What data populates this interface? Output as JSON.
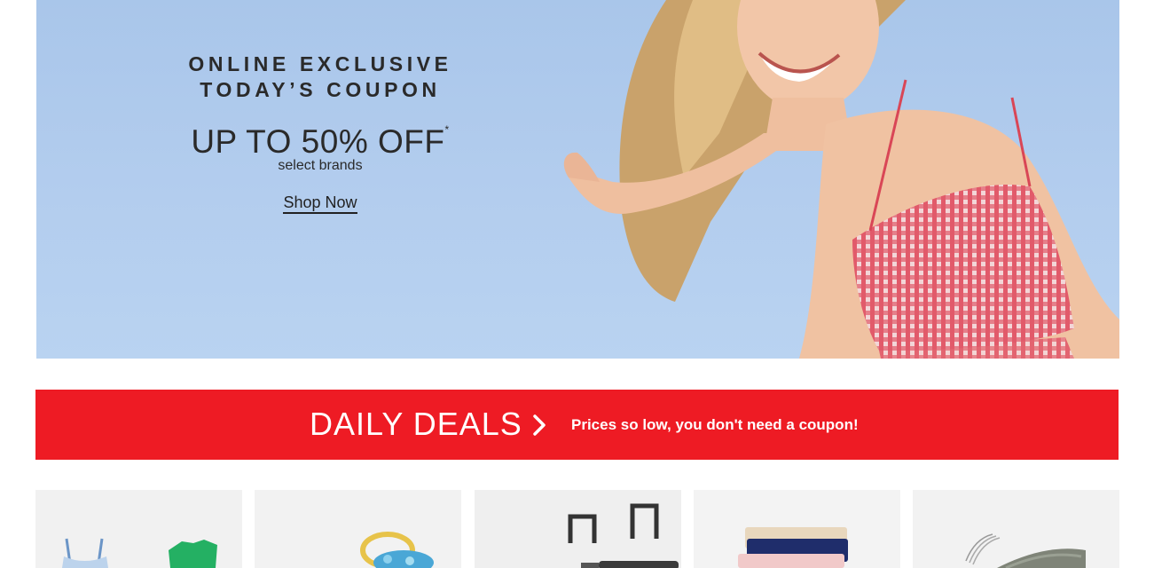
{
  "hero": {
    "line1": "ONLINE EXCLUSIVE",
    "line2": "TODAY’S COUPON",
    "offer": "UP TO 50% OFF",
    "offer_mark": "*",
    "subtext": "select brands",
    "cta": "Shop Now",
    "image": "smiling-woman-red-gingham-top"
  },
  "deals_banner": {
    "title": "DAILY DEALS",
    "tagline": "Prices so low, you don't need a coupon!",
    "color": "#ee1b24",
    "icon": "chevron-right-icon"
  },
  "category_tiles": [
    {
      "image": "swimwear"
    },
    {
      "image": "jewelry"
    },
    {
      "image": "luggage"
    },
    {
      "image": "underwear"
    },
    {
      "image": "hangers"
    }
  ]
}
